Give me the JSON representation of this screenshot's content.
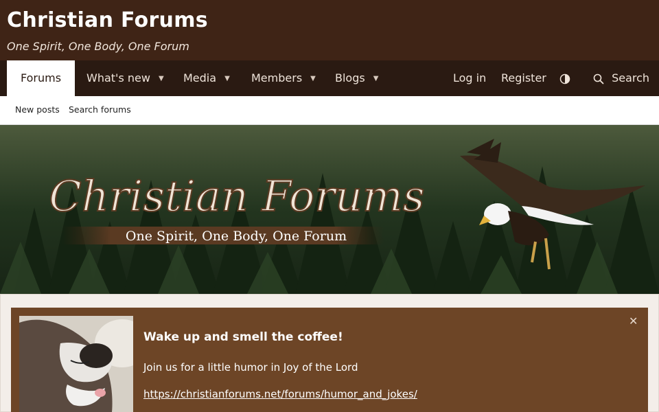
{
  "header": {
    "title": "Christian Forums",
    "tagline": "One Spirit, One Body, One Forum"
  },
  "nav": {
    "items": [
      {
        "label": "Forums",
        "active": true
      },
      {
        "label": "What's new",
        "dropdown": true
      },
      {
        "label": "Media",
        "dropdown": true
      },
      {
        "label": "Members",
        "dropdown": true
      },
      {
        "label": "Blogs",
        "dropdown": true
      }
    ],
    "login": "Log in",
    "register": "Register",
    "style_toggle_icon": "contrast-icon",
    "search_icon": "search-icon",
    "search": "Search"
  },
  "subnav": {
    "new_posts": "New posts",
    "search_forums": "Search forums"
  },
  "banner": {
    "title": "Christian Forums",
    "tagline": "One Spirit, One Body, One Forum"
  },
  "notice": {
    "title": "Wake up and smell the coffee!",
    "text": "Join us for a little humor in Joy of the Lord",
    "link": "https://christianforums.net/forums/humor_and_jokes/",
    "close_icon": "close-icon"
  },
  "colors": {
    "header_bg": "#3f2416",
    "nav_bg": "#2a1a12",
    "notice_bg": "#6d4526"
  }
}
